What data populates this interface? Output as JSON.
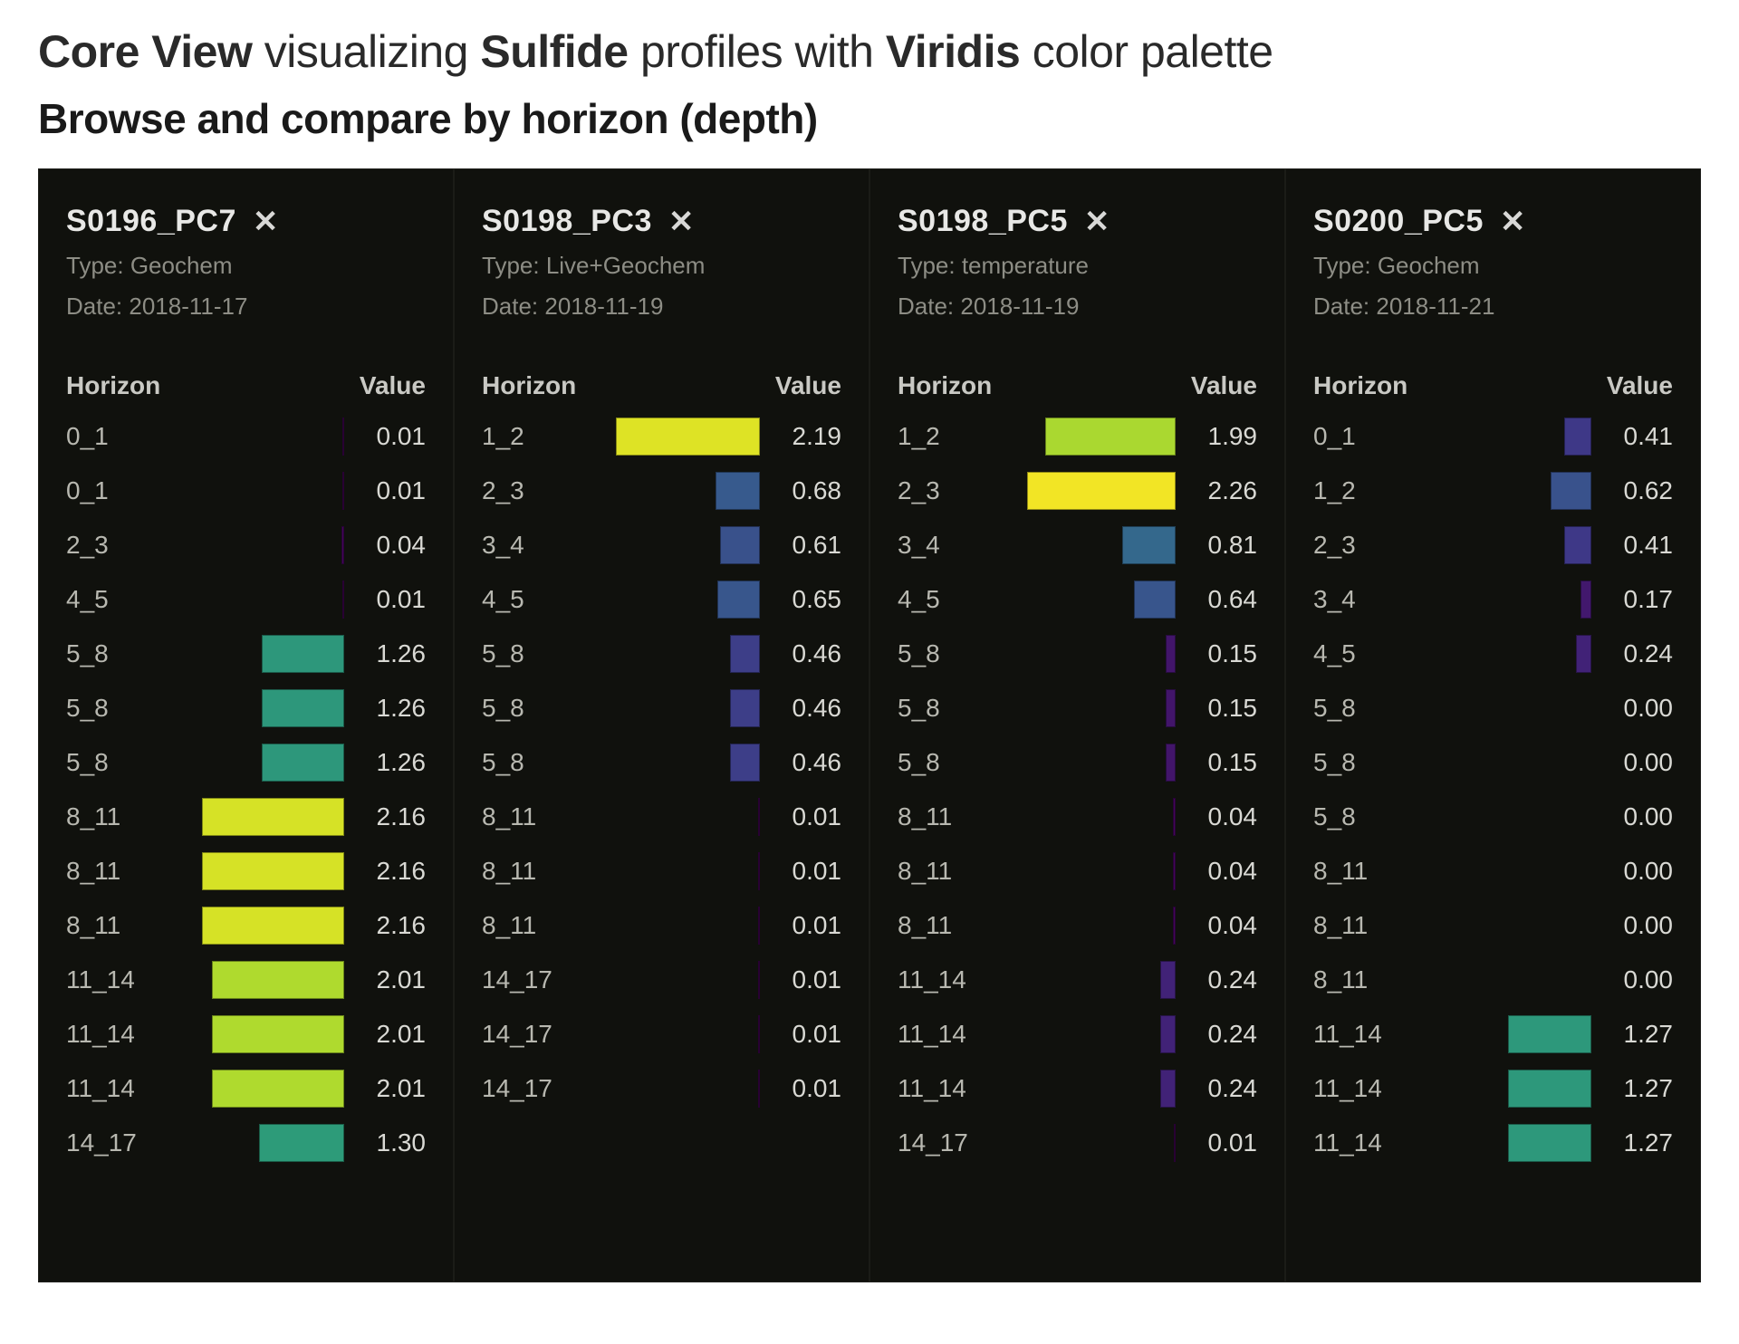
{
  "header": {
    "title_main": "Core View",
    "title_mid1": "visualizing",
    "title_bold1": "Sulfide",
    "title_mid2": "profiles with",
    "title_bold2": "Viridis",
    "title_mid3": "color palette",
    "subtitle": "Browse and compare by horizon (depth)"
  },
  "labels": {
    "type_prefix": "Type: ",
    "date_prefix": "Date: ",
    "col_horizon": "Horizon",
    "col_value": "Value"
  },
  "chart_data": {
    "type": "bar",
    "title": "Core View — Sulfide profiles (Viridis)",
    "xlabel": "Value",
    "ylabel": "Horizon (depth)",
    "value_range": [
      0,
      2.3
    ],
    "palette": "viridis",
    "cores": [
      {
        "id": "S0196_PC7",
        "type": "Geochem",
        "date": "2018-11-17",
        "rows": [
          {
            "horizon": "0_1",
            "value": 0.01
          },
          {
            "horizon": "0_1",
            "value": 0.01
          },
          {
            "horizon": "2_3",
            "value": 0.04
          },
          {
            "horizon": "4_5",
            "value": 0.01
          },
          {
            "horizon": "5_8",
            "value": 1.26
          },
          {
            "horizon": "5_8",
            "value": 1.26
          },
          {
            "horizon": "5_8",
            "value": 1.26
          },
          {
            "horizon": "8_11",
            "value": 2.16
          },
          {
            "horizon": "8_11",
            "value": 2.16
          },
          {
            "horizon": "8_11",
            "value": 2.16
          },
          {
            "horizon": "11_14",
            "value": 2.01
          },
          {
            "horizon": "11_14",
            "value": 2.01
          },
          {
            "horizon": "11_14",
            "value": 2.01
          },
          {
            "horizon": "14_17",
            "value": 1.3
          }
        ]
      },
      {
        "id": "S0198_PC3",
        "type": "Live+Geochem",
        "date": "2018-11-19",
        "rows": [
          {
            "horizon": "1_2",
            "value": 2.19
          },
          {
            "horizon": "2_3",
            "value": 0.68
          },
          {
            "horizon": "3_4",
            "value": 0.61
          },
          {
            "horizon": "4_5",
            "value": 0.65
          },
          {
            "horizon": "5_8",
            "value": 0.46
          },
          {
            "horizon": "5_8",
            "value": 0.46
          },
          {
            "horizon": "5_8",
            "value": 0.46
          },
          {
            "horizon": "8_11",
            "value": 0.01
          },
          {
            "horizon": "8_11",
            "value": 0.01
          },
          {
            "horizon": "8_11",
            "value": 0.01
          },
          {
            "horizon": "14_17",
            "value": 0.01
          },
          {
            "horizon": "14_17",
            "value": 0.01
          },
          {
            "horizon": "14_17",
            "value": 0.01
          }
        ]
      },
      {
        "id": "S0198_PC5",
        "type": "temperature",
        "date": "2018-11-19",
        "rows": [
          {
            "horizon": "1_2",
            "value": 1.99
          },
          {
            "horizon": "2_3",
            "value": 2.26
          },
          {
            "horizon": "3_4",
            "value": 0.81
          },
          {
            "horizon": "4_5",
            "value": 0.64
          },
          {
            "horizon": "5_8",
            "value": 0.15
          },
          {
            "horizon": "5_8",
            "value": 0.15
          },
          {
            "horizon": "5_8",
            "value": 0.15
          },
          {
            "horizon": "8_11",
            "value": 0.04
          },
          {
            "horizon": "8_11",
            "value": 0.04
          },
          {
            "horizon": "8_11",
            "value": 0.04
          },
          {
            "horizon": "11_14",
            "value": 0.24
          },
          {
            "horizon": "11_14",
            "value": 0.24
          },
          {
            "horizon": "11_14",
            "value": 0.24
          },
          {
            "horizon": "14_17",
            "value": 0.01
          }
        ]
      },
      {
        "id": "S0200_PC5",
        "type": "Geochem",
        "date": "2018-11-21",
        "rows": [
          {
            "horizon": "0_1",
            "value": 0.41
          },
          {
            "horizon": "1_2",
            "value": 0.62
          },
          {
            "horizon": "2_3",
            "value": 0.41
          },
          {
            "horizon": "3_4",
            "value": 0.17
          },
          {
            "horizon": "4_5",
            "value": 0.24
          },
          {
            "horizon": "5_8",
            "value": 0.0
          },
          {
            "horizon": "5_8",
            "value": 0.0
          },
          {
            "horizon": "5_8",
            "value": 0.0
          },
          {
            "horizon": "8_11",
            "value": 0.0
          },
          {
            "horizon": "8_11",
            "value": 0.0
          },
          {
            "horizon": "8_11",
            "value": 0.0
          },
          {
            "horizon": "11_14",
            "value": 1.27
          },
          {
            "horizon": "11_14",
            "value": 1.27
          },
          {
            "horizon": "11_14",
            "value": 1.27
          }
        ]
      }
    ]
  }
}
